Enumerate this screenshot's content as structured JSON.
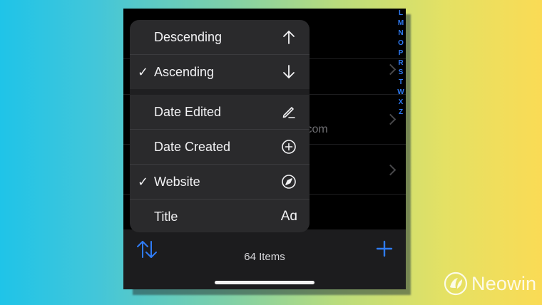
{
  "background_row": {
    "partial_text": ".com"
  },
  "index_letters": [
    "L",
    "M",
    "N",
    "O",
    "P",
    "R",
    "S",
    "T",
    "W",
    "X",
    "Z"
  ],
  "sort_menu": {
    "order_items": [
      {
        "label": "Descending",
        "checked": false,
        "icon": "arrow-up-icon"
      },
      {
        "label": "Ascending",
        "checked": true,
        "icon": "arrow-down-icon"
      }
    ],
    "field_items": [
      {
        "label": "Date Edited",
        "checked": false,
        "icon": "pencil-icon"
      },
      {
        "label": "Date Created",
        "checked": false,
        "icon": "plus-circle-icon"
      },
      {
        "label": "Website",
        "checked": true,
        "icon": "compass-icon"
      },
      {
        "label": "Title",
        "checked": false,
        "icon": "font-size-icon"
      }
    ],
    "check_glyph": "✓",
    "title_icon_text": "Aɑ"
  },
  "toolbar": {
    "items_count": "64 Items"
  },
  "watermark": {
    "text": "Neowin"
  },
  "colors": {
    "accent": "#2f7cf6",
    "menu_background": "#2a2a2c",
    "toolbar_background": "#1c1c1e"
  }
}
